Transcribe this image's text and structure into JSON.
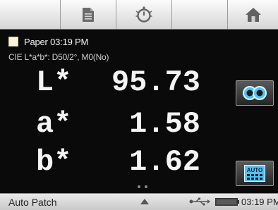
{
  "toolbar": {
    "buttons": [
      {
        "icon": "blank"
      },
      {
        "icon": "document-icon"
      },
      {
        "icon": "measure-timer-icon"
      },
      {
        "icon": "blank"
      },
      {
        "icon": "home-icon"
      }
    ]
  },
  "sample": {
    "swatch_color": "#fbf4d9",
    "name": "Paper 03:19 PM",
    "conditions": "CIE L*a*b*: D50/2°, M0(No)"
  },
  "values": [
    {
      "label": "L*",
      "value": "95.73"
    },
    {
      "label": "a*",
      "value": "1.58"
    },
    {
      "label": "b*",
      "value": "1.62"
    }
  ],
  "side_buttons": {
    "top_icon": "compare-icon",
    "bottom_label": "AUTO"
  },
  "pager": {
    "pages": 2
  },
  "status": {
    "mode": "Auto Patch",
    "time": "03:19 PM"
  },
  "colors": {
    "background": "#000000",
    "toolbar": "#e4e4e4",
    "accent_blue": "#4fc3f7"
  }
}
